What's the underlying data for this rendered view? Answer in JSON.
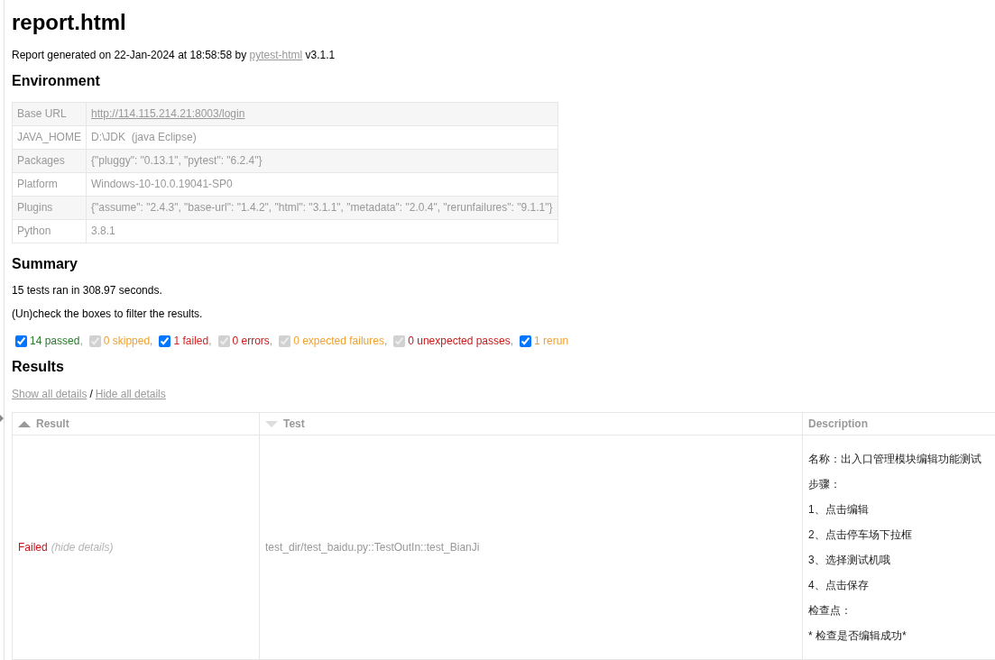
{
  "title": "report.html",
  "report_info": {
    "text": "Report generated on 22-Jan-2024 at 18:58:58 by",
    "link": "pytest-html",
    "version": "v3.1.1"
  },
  "environment": {
    "heading": "Environment",
    "rows": [
      {
        "kind": "link",
        "key": "Base URL",
        "value": "http://114.115.214.21:8003/login"
      },
      {
        "kind": "text",
        "key": "JAVA_HOME",
        "value": "D:\\JDK  (java Eclipse)"
      },
      {
        "kind": "text",
        "key": "Packages",
        "value": "{\"pluggy\": \"0.13.1\", \"pytest\": \"6.2.4\"}"
      },
      {
        "kind": "text",
        "key": "Platform",
        "value": "Windows-10-10.0.19041-SP0"
      },
      {
        "kind": "text",
        "key": "Plugins",
        "value": "{\"assume\": \"2.4.3\", \"base-url\": \"1.4.2\", \"html\": \"3.1.1\", \"metadata\": \"2.0.4\", \"rerunfailures\": \"9.1.1\"}"
      },
      {
        "kind": "text",
        "key": "Python",
        "value": "3.8.1"
      }
    ]
  },
  "summary": {
    "heading": "Summary",
    "stats": "15 tests ran in 308.97 seconds.",
    "hint": "(Un)check the boxes to filter the results.",
    "filters": [
      {
        "label": "14 passed",
        "color": "#2a7a2a",
        "checked": true,
        "disabled": false,
        "suffix": ","
      },
      {
        "label": "0 skipped",
        "color": "#f0a030",
        "checked": true,
        "disabled": true,
        "suffix": ","
      },
      {
        "label": "1 failed",
        "color": "#d42424",
        "checked": true,
        "disabled": false,
        "suffix": ","
      },
      {
        "label": "0 errors",
        "color": "#c41a1a",
        "checked": true,
        "disabled": true,
        "suffix": ","
      },
      {
        "label": "0 expected failures",
        "color": "#f0a030",
        "checked": true,
        "disabled": true,
        "suffix": ","
      },
      {
        "label": "0 unexpected passes",
        "color": "#c41a1a",
        "checked": true,
        "disabled": true,
        "suffix": ","
      },
      {
        "label": "1 rerun",
        "color": "#f0a030",
        "checked": true,
        "disabled": false
      }
    ]
  },
  "results": {
    "heading": "Results",
    "detail_links": [
      {
        "label": "Show all details"
      },
      {
        "label": "Hide all details"
      }
    ],
    "link_separator": "/",
    "table": {
      "columns": [
        {
          "label": "Result",
          "kind": "ascending",
          "sort_active": true
        },
        {
          "label": "Test",
          "kind": "descending",
          "sort_active": false
        },
        {
          "label": "Description",
          "kind": "plain"
        }
      ],
      "rows": [
        {
          "kind": "failed",
          "result": "Failed",
          "toggle": "(hide details)",
          "test": "test_dir/test_baidu.py::TestOutIn::test_BianJi",
          "description": [
            "名称：出入口管理模块编辑功能测试",
            "步骤：",
            "1、点击编辑",
            "2、点击停车场下拉框",
            "3、选择测试机哦",
            "4、点击保存",
            "检查点：",
            "* 检查是否编辑成功*"
          ]
        }
      ]
    }
  }
}
